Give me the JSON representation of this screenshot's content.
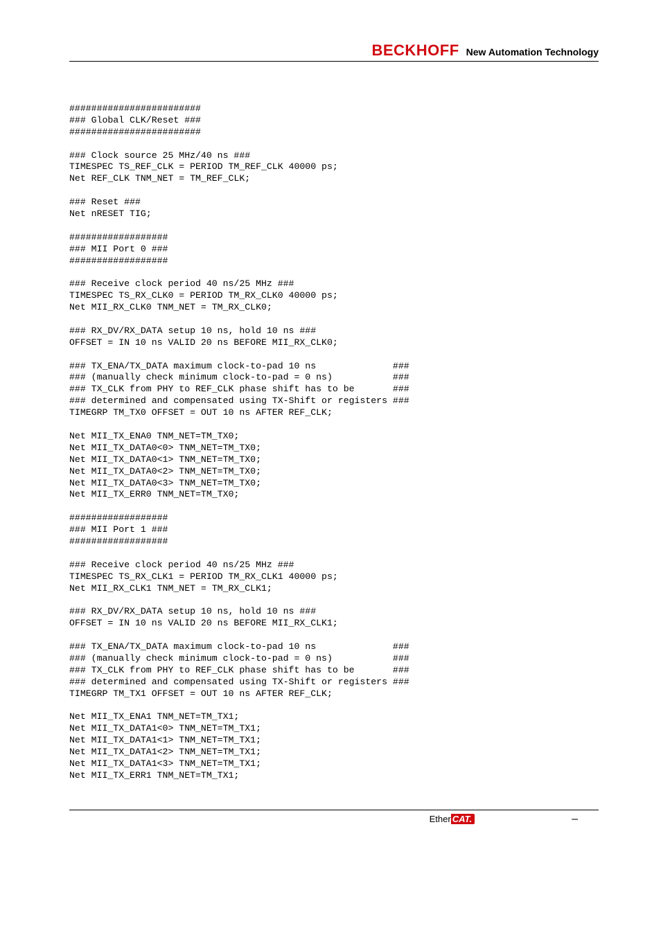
{
  "header": {
    "brand": "BECKHOFF",
    "tagline": "New Automation Technology"
  },
  "code": "########################\n### Global CLK/Reset ###\n########################\n\n### Clock source 25 MHz/40 ns ###\nTIMESPEC TS_REF_CLK = PERIOD TM_REF_CLK 40000 ps;\nNet REF_CLK TNM_NET = TM_REF_CLK;\n\n### Reset ###\nNet nRESET TIG;\n\n##################\n### MII Port 0 ###\n##################\n\n### Receive clock period 40 ns/25 MHz ###\nTIMESPEC TS_RX_CLK0 = PERIOD TM_RX_CLK0 40000 ps;\nNet MII_RX_CLK0 TNM_NET = TM_RX_CLK0;\n\n### RX_DV/RX_DATA setup 10 ns, hold 10 ns ###\nOFFSET = IN 10 ns VALID 20 ns BEFORE MII_RX_CLK0;\n\n### TX_ENA/TX_DATA maximum clock-to-pad 10 ns              ###\n### (manually check minimum clock-to-pad = 0 ns)           ###\n### TX_CLK from PHY to REF_CLK phase shift has to be       ###\n### determined and compensated using TX-Shift or registers ###\nTIMEGRP TM_TX0 OFFSET = OUT 10 ns AFTER REF_CLK;\n\nNet MII_TX_ENA0 TNM_NET=TM_TX0;\nNet MII_TX_DATA0<0> TNM_NET=TM_TX0;\nNet MII_TX_DATA0<1> TNM_NET=TM_TX0;\nNet MII_TX_DATA0<2> TNM_NET=TM_TX0;\nNet MII_TX_DATA0<3> TNM_NET=TM_TX0;\nNet MII_TX_ERR0 TNM_NET=TM_TX0;\n\n##################\n### MII Port 1 ###\n##################\n\n### Receive clock period 40 ns/25 MHz ###\nTIMESPEC TS_RX_CLK1 = PERIOD TM_RX_CLK1 40000 ps;\nNet MII_RX_CLK1 TNM_NET = TM_RX_CLK1;\n\n### RX_DV/RX_DATA setup 10 ns, hold 10 ns ###\nOFFSET = IN 10 ns VALID 20 ns BEFORE MII_RX_CLK1;\n\n### TX_ENA/TX_DATA maximum clock-to-pad 10 ns              ###\n### (manually check minimum clock-to-pad = 0 ns)           ###\n### TX_CLK from PHY to REF_CLK phase shift has to be       ###\n### determined and compensated using TX-Shift or registers ###\nTIMEGRP TM_TX1 OFFSET = OUT 10 ns AFTER REF_CLK;\n\nNet MII_TX_ENA1 TNM_NET=TM_TX1;\nNet MII_TX_DATA1<0> TNM_NET=TM_TX1;\nNet MII_TX_DATA1<1> TNM_NET=TM_TX1;\nNet MII_TX_DATA1<2> TNM_NET=TM_TX1;\nNet MII_TX_DATA1<3> TNM_NET=TM_TX1;\nNet MII_TX_ERR1 TNM_NET=TM_TX1;",
  "footer": {
    "ether_prefix": "Ether",
    "ether_suffix": "CAT.",
    "dash": "–"
  }
}
